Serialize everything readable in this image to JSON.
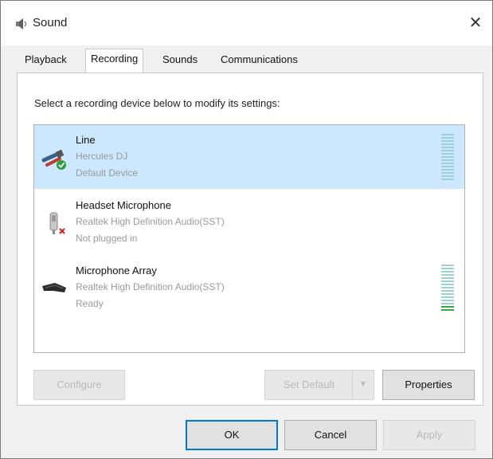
{
  "window": {
    "title": "Sound",
    "close_glyph": "✕"
  },
  "tabs": [
    {
      "label": "Playback",
      "active": false
    },
    {
      "label": "Recording",
      "active": true
    },
    {
      "label": "Sounds",
      "active": false
    },
    {
      "label": "Communications",
      "active": false
    }
  ],
  "panel": {
    "instruction": "Select a recording device below to modify its settings:"
  },
  "devices": [
    {
      "name": "Line",
      "description": "Hercules DJ",
      "status": "Default Device",
      "selected": true,
      "icon": "line-in-icon",
      "level": 0
    },
    {
      "name": "Headset Microphone",
      "description": "Realtek High Definition Audio(SST)",
      "status": "Not plugged in",
      "selected": false,
      "icon": "headset-microphone-icon",
      "level": null
    },
    {
      "name": "Microphone Array",
      "description": "Realtek High Definition Audio(SST)",
      "status": "Ready",
      "selected": false,
      "icon": "microphone-array-icon",
      "level": 0.15
    }
  ],
  "buttons": {
    "configure": "Configure",
    "set_default": "Set Default",
    "properties": "Properties",
    "ok": "OK",
    "cancel": "Cancel",
    "apply": "Apply"
  },
  "colors": {
    "selection": "#cce8ff",
    "meter_active": "#3aa53a",
    "meter_idle": "#9ccfd6",
    "focus_border": "#0078d7"
  }
}
